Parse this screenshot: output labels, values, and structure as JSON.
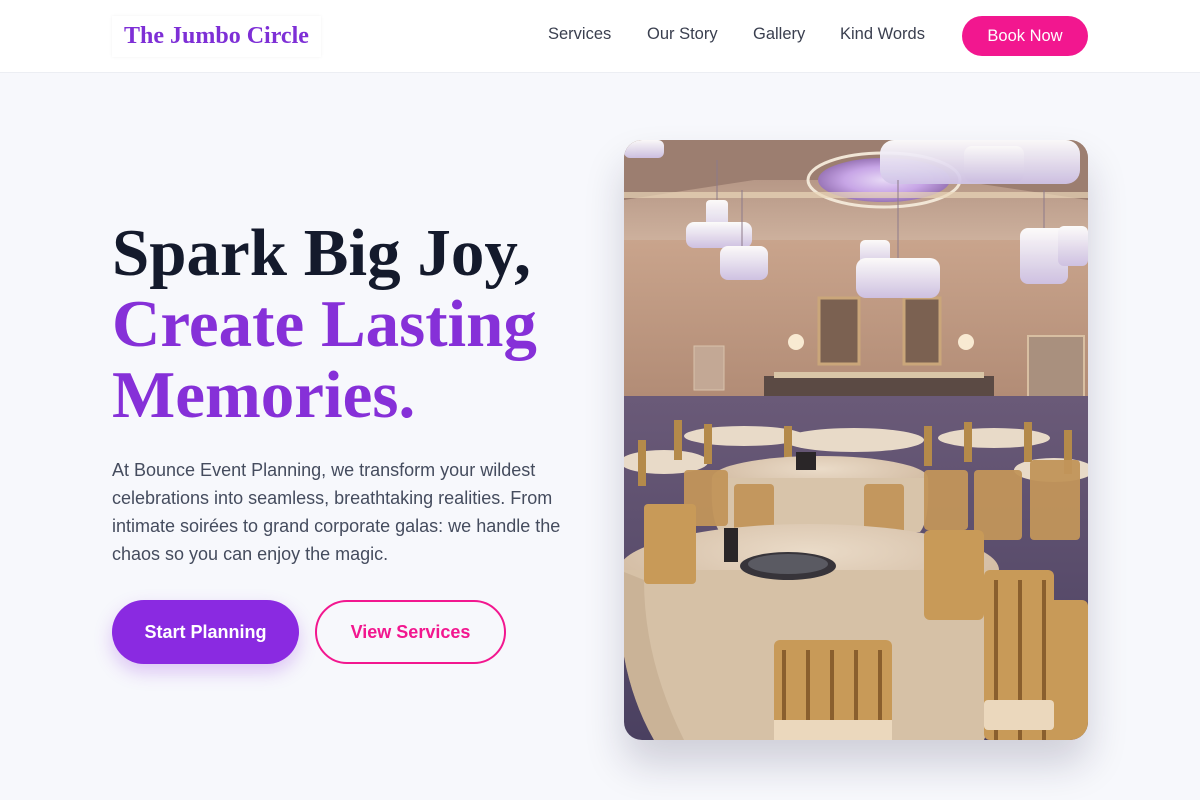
{
  "header": {
    "logo": "The Jumbo Circle",
    "nav": [
      "Services",
      "Our Story",
      "Gallery",
      "Kind Words"
    ],
    "cta": "Book Now"
  },
  "hero": {
    "headline_line1": "Spark Big Joy,",
    "headline_line2": "Create Lasting",
    "headline_line3": "Memories.",
    "description": "At Bounce Event Planning, we transform your wildest celebrations into seamless, breathtaking realities. From intimate soirées to grand corporate galas: we handle the chaos so you can enjoy the magic.",
    "primary_button": "Start Planning",
    "secondary_button": "View Services",
    "image_subject": "banquet-hall-photo"
  },
  "colors": {
    "brand_purple": "#8a2ae1",
    "accent_pink": "#f2178f",
    "heading_dark": "#141a2c",
    "background": "#f7f8fc"
  }
}
